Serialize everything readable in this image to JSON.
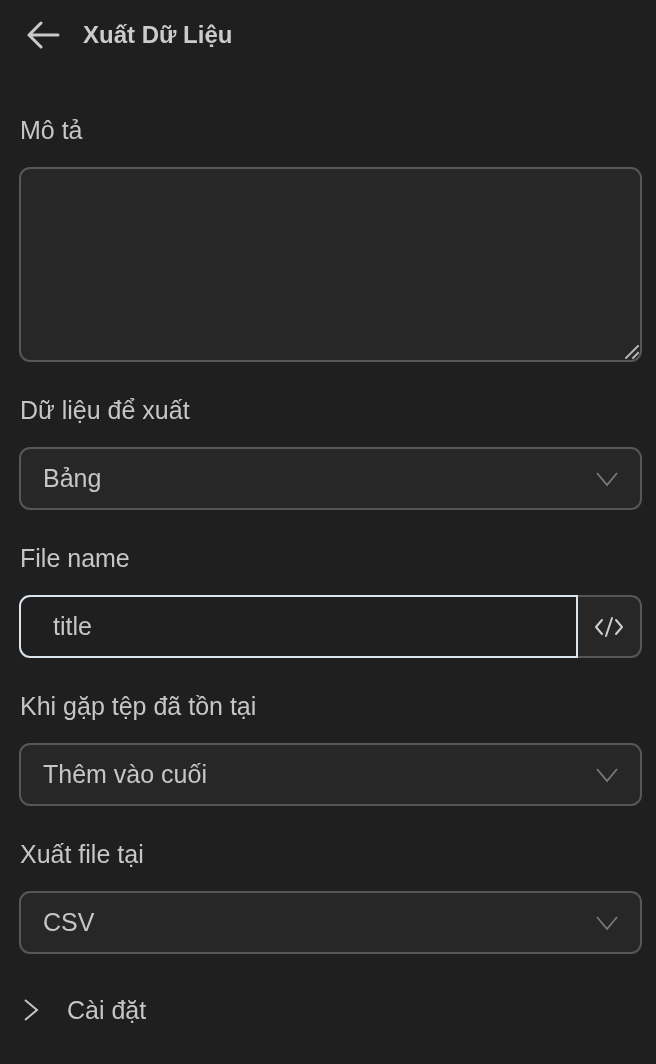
{
  "header": {
    "title": "Xuất Dữ Liệu"
  },
  "fields": [
    {
      "kind": "textarea",
      "label": "Mô tả"
    },
    {
      "kind": "select",
      "label": "Dữ liệu để xuất",
      "value": "Bảng"
    },
    {
      "kind": "text",
      "label": "File name",
      "value": "title",
      "focused": true
    },
    {
      "kind": "select",
      "label": "Khi gặp tệp đã tồn tại",
      "value": "Thêm vào cuối"
    },
    {
      "kind": "select",
      "label": "Xuất file tại",
      "value": "CSV"
    }
  ],
  "sections": [
    {
      "label": "Cài đặt",
      "expanded": false
    }
  ]
}
